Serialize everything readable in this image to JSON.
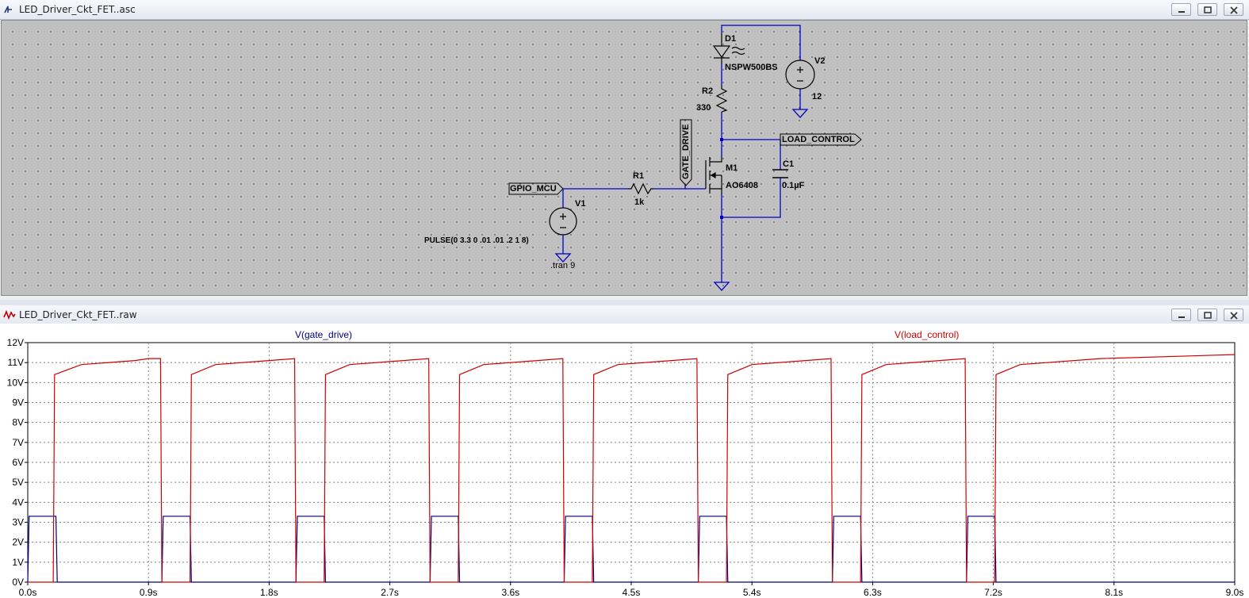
{
  "schematic_window": {
    "title": "LED_Driver_Ckt_FET..asc",
    "icon": "schematic-icon",
    "components": {
      "d1": {
        "ref": "D1",
        "value": "NSPW500BS"
      },
      "v2": {
        "ref": "V2",
        "value": "12"
      },
      "r2": {
        "ref": "R2",
        "value": "330"
      },
      "m1": {
        "ref": "M1",
        "value": "AO6408"
      },
      "c1": {
        "ref": "C1",
        "value": "0.1µF"
      },
      "r1": {
        "ref": "R1",
        "value": "1k"
      },
      "v1": {
        "ref": "V1",
        "value": "PULSE(0 3.3 0 .01 .01 .2 1 8)"
      }
    },
    "net_labels": {
      "load_control": "LOAD_CONTROL",
      "gate_drive": "GATE_DRIVE",
      "gpio_mcu": "GPIO_MCU"
    },
    "directive": ".tran 9"
  },
  "waveform_window": {
    "title": "LED_Driver_Ckt_FET..raw",
    "icon": "waveform-icon",
    "traces": [
      {
        "name": "V(gate_drive)",
        "color": "#00007f"
      },
      {
        "name": "V(load_control)",
        "color": "#d00000"
      }
    ]
  },
  "chart_data": {
    "type": "line",
    "xlabel": "",
    "ylabel": "",
    "xlim": [
      0,
      9
    ],
    "ylim": [
      0,
      12
    ],
    "grid": true,
    "y_ticks": [
      "0V",
      "1V",
      "2V",
      "3V",
      "4V",
      "5V",
      "6V",
      "7V",
      "8V",
      "9V",
      "10V",
      "11V",
      "12V"
    ],
    "x_ticks": [
      "0.0s",
      "0.9s",
      "1.8s",
      "2.7s",
      "3.6s",
      "4.5s",
      "5.4s",
      "6.3s",
      "7.2s",
      "8.1s",
      "9.0s"
    ],
    "series": [
      {
        "name": "V(gate_drive)",
        "color": "#00007f",
        "pulse": {
          "low": 0,
          "high": 3.3,
          "delay": 0,
          "rise": 0.01,
          "fall": 0.01,
          "on": 0.2,
          "period": 1,
          "cycles": 8
        }
      },
      {
        "name": "V(load_control)",
        "color": "#d00000",
        "points": [
          [
            0,
            0
          ],
          [
            0.19,
            0
          ],
          [
            0.2,
            10.4
          ],
          [
            0.4,
            10.9
          ],
          [
            0.8,
            11.1
          ],
          [
            0.9,
            11.2
          ],
          [
            0.99,
            11.2
          ],
          [
            1,
            0
          ],
          [
            1.21,
            0
          ],
          [
            1.22,
            10.4
          ],
          [
            1.4,
            10.9
          ],
          [
            1.8,
            11.1
          ],
          [
            1.99,
            11.2
          ],
          [
            2,
            0
          ],
          [
            2.21,
            0
          ],
          [
            2.22,
            10.4
          ],
          [
            2.4,
            10.9
          ],
          [
            2.8,
            11.1
          ],
          [
            2.99,
            11.2
          ],
          [
            3,
            0
          ],
          [
            3.21,
            0
          ],
          [
            3.22,
            10.4
          ],
          [
            3.4,
            10.9
          ],
          [
            3.8,
            11.1
          ],
          [
            3.99,
            11.2
          ],
          [
            4,
            0
          ],
          [
            4.21,
            0
          ],
          [
            4.22,
            10.4
          ],
          [
            4.4,
            10.9
          ],
          [
            4.8,
            11.1
          ],
          [
            4.99,
            11.2
          ],
          [
            5,
            0
          ],
          [
            5.21,
            0
          ],
          [
            5.22,
            10.4
          ],
          [
            5.4,
            10.9
          ],
          [
            5.8,
            11.1
          ],
          [
            5.99,
            11.2
          ],
          [
            6,
            0
          ],
          [
            6.21,
            0
          ],
          [
            6.22,
            10.4
          ],
          [
            6.4,
            10.9
          ],
          [
            6.8,
            11.1
          ],
          [
            6.99,
            11.2
          ],
          [
            7,
            0
          ],
          [
            7.21,
            0
          ],
          [
            7.22,
            10.4
          ],
          [
            7.4,
            10.9
          ],
          [
            8.0,
            11.2
          ],
          [
            9.0,
            11.4
          ]
        ]
      }
    ]
  }
}
